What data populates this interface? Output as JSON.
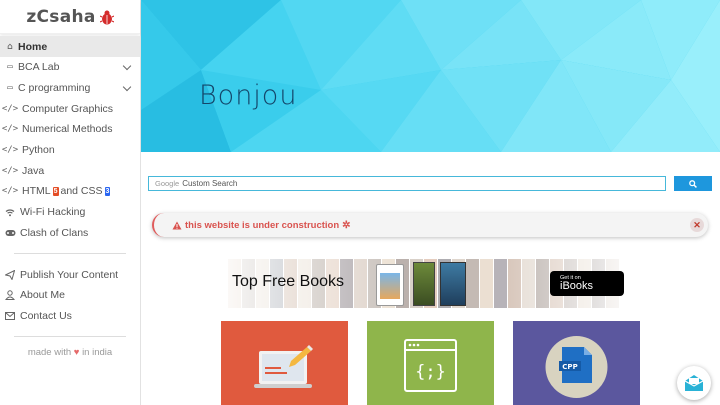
{
  "logo": {
    "text": "zCsaha"
  },
  "sidebar": {
    "items": [
      {
        "label": "Home",
        "icon": "home-icon",
        "active": true
      },
      {
        "label": "BCA Lab",
        "icon": "folder-icon",
        "expandable": true
      },
      {
        "label": "C programming",
        "icon": "folder-icon",
        "expandable": true
      },
      {
        "label": "Computer Graphics",
        "icon": "code-icon"
      },
      {
        "label": "Numerical Methods",
        "icon": "code-icon"
      },
      {
        "label": "Python",
        "icon": "code-icon"
      },
      {
        "label": "Java",
        "icon": "code-icon"
      },
      {
        "label": "HTML",
        "label2": "and CSS",
        "icon": "code-icon"
      },
      {
        "label": "Wi-Fi Hacking",
        "icon": "wifi-icon"
      },
      {
        "label": "Clash of Clans",
        "icon": "gamepad-icon"
      }
    ],
    "secondary": [
      {
        "label": "Publish Your Content",
        "icon": "send-icon"
      },
      {
        "label": "About Me",
        "icon": "user-icon"
      },
      {
        "label": "Contact Us",
        "icon": "envelope-icon"
      }
    ],
    "footer": {
      "prefix": "made with",
      "suffix": "in india"
    }
  },
  "hero": {
    "title": "Bonjou"
  },
  "search": {
    "placeholder": "Custom Search",
    "brand": "Google"
  },
  "alert": {
    "text": "this website is under construction"
  },
  "banner": {
    "title": "Top Free Books",
    "ibooks_small": "Get it on",
    "ibooks_large": "iBooks"
  },
  "colors": {
    "accent": "#1e97dd",
    "alert": "#d9534f",
    "tile_red": "#e05a3e",
    "tile_green": "#8fb54b",
    "tile_purple": "#5b579e"
  }
}
